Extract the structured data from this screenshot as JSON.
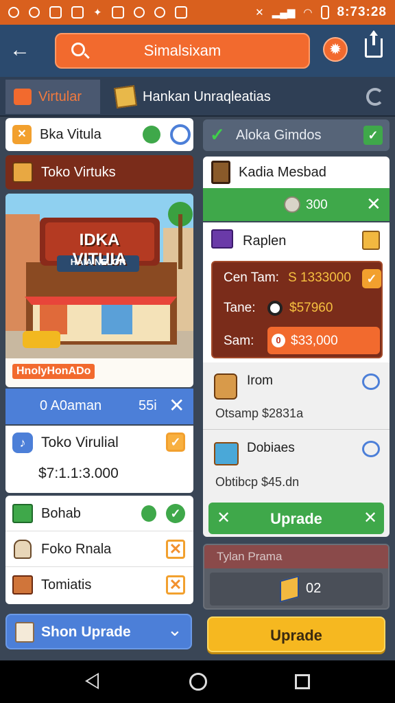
{
  "status_bar": {
    "time": "8:73:28",
    "icons_left": [
      "location-icon",
      "bell-icon",
      "bag-icon",
      "mail-icon",
      "navigation-icon",
      "game-icon",
      "whatsapp-icon",
      "camera-icon",
      "photo-icon"
    ],
    "icons_right": [
      "mute-icon",
      "signal-icon",
      "wifi-icon",
      "battery-icon"
    ]
  },
  "topbar": {
    "search_label": "Simalsixam"
  },
  "tabs": {
    "active": "Virtular",
    "second": "Hankan Unraqleatias"
  },
  "left": {
    "shop_name_row": {
      "label": "Bka Vitula"
    },
    "section_header": {
      "label": "Toko Virtuks"
    },
    "banner": {
      "sign_main": "IDKA VITUIA",
      "sign_sub": "HAIA NELOR",
      "tag": "HnolyHonADo"
    },
    "blue_row": {
      "label": "0 A0aman",
      "value": "55i"
    },
    "toko": {
      "name": "Toko Virulial",
      "price": "$7:1.1:3.000"
    },
    "items": [
      {
        "label": "Bohab",
        "mark": "green-check"
      },
      {
        "label": "Foko Rnala",
        "mark": "orange-x"
      },
      {
        "label": "Tomiatis",
        "mark": "orange-x"
      }
    ],
    "shop_upgrade": {
      "label": "Shon Uprade"
    }
  },
  "right": {
    "header": {
      "label": "Aloka Gimdos"
    },
    "kadia": {
      "label": "Kadia Mesbad",
      "coin_value": "300"
    },
    "raplen": {
      "label": "Raplen",
      "stats": [
        {
          "label": "Cen Tam:",
          "value": "S 1333000"
        },
        {
          "label": "Tane:",
          "value": "$57960"
        },
        {
          "label": "Sam:",
          "value": "$33,000"
        }
      ]
    },
    "irom": {
      "label": "Irom",
      "sub": "Otsamp $2831a"
    },
    "dobiaes": {
      "label": "Dobiaes",
      "sub": "Obtibcp $45.dn"
    },
    "upgrade_green": {
      "label": "Uprade"
    },
    "disabled_panel": {
      "title": "Tylan Prama",
      "value": "02"
    },
    "upgrade_yellow": {
      "label": "Uprade"
    }
  },
  "colors": {
    "orange": "#f26a2e",
    "navy": "#2b4a6e",
    "green": "#3fa84a",
    "yellow": "#f6b820",
    "blue": "#4c7fd8",
    "brown": "#7a2c1a"
  }
}
